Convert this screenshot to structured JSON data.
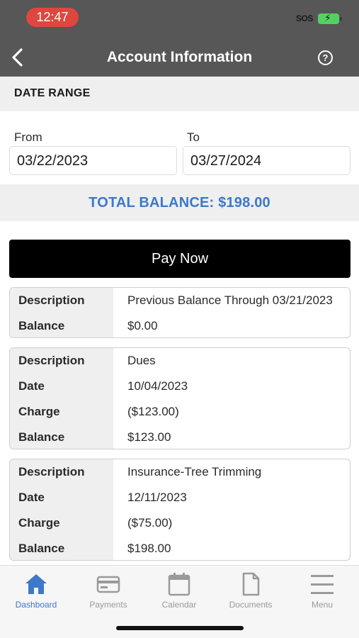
{
  "status_bar": {
    "time": "12:47",
    "carrier": "SOS"
  },
  "header": {
    "title": "Account Information"
  },
  "date_range": {
    "heading": "DATE RANGE",
    "from_label": "From",
    "from_value": "03/22/2023",
    "to_label": "To",
    "to_value": "03/27/2024"
  },
  "total_balance": "TOTAL BALANCE: $198.00",
  "pay_now_label": "Pay Now",
  "transactions": [
    {
      "rows": [
        {
          "key": "Description",
          "value": "Previous Balance Through 03/21/2023"
        },
        {
          "key": "Balance",
          "value": "$0.00"
        }
      ]
    },
    {
      "rows": [
        {
          "key": "Description",
          "value": "Dues"
        },
        {
          "key": "Date",
          "value": "10/04/2023"
        },
        {
          "key": "Charge",
          "value": "($123.00)"
        },
        {
          "key": "Balance",
          "value": "$123.00"
        }
      ]
    },
    {
      "rows": [
        {
          "key": "Description",
          "value": "Insurance-Tree Trimming"
        },
        {
          "key": "Date",
          "value": "12/11/2023"
        },
        {
          "key": "Charge",
          "value": "($75.00)"
        },
        {
          "key": "Balance",
          "value": "$198.00"
        }
      ]
    }
  ],
  "tab_bar": [
    {
      "label": "Dashboard",
      "icon": "home-icon",
      "active": true
    },
    {
      "label": "Payments",
      "icon": "credit-card-icon",
      "active": false
    },
    {
      "label": "Calendar",
      "icon": "calendar-icon",
      "active": false
    },
    {
      "label": "Documents",
      "icon": "document-icon",
      "active": false
    },
    {
      "label": "Menu",
      "icon": "menu-icon",
      "active": false
    }
  ],
  "colors": {
    "accent": "#3d78c9",
    "header_bg": "#575757",
    "pay_button": "#000000"
  }
}
